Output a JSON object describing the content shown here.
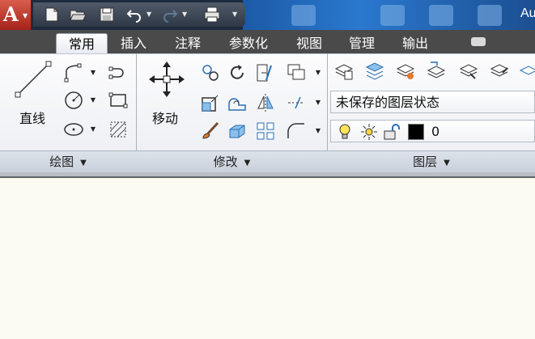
{
  "app": {
    "title_fragment": "Au"
  },
  "tabs": [
    {
      "label": "常用",
      "active": true
    },
    {
      "label": "插入"
    },
    {
      "label": "注释"
    },
    {
      "label": "参数化"
    },
    {
      "label": "视图"
    },
    {
      "label": "管理"
    },
    {
      "label": "输出"
    }
  ],
  "draw_panel": {
    "title": "绘图",
    "line_label": "直线"
  },
  "modify_panel": {
    "title": "修改",
    "move_label": "移动"
  },
  "layers_panel": {
    "title": "图层",
    "layer_state": "未保存的图层状态",
    "current_layer": "0",
    "layer_color": "#000000"
  },
  "colors": {
    "accent": "#1c5aa6",
    "app_button": "#c0392b"
  }
}
